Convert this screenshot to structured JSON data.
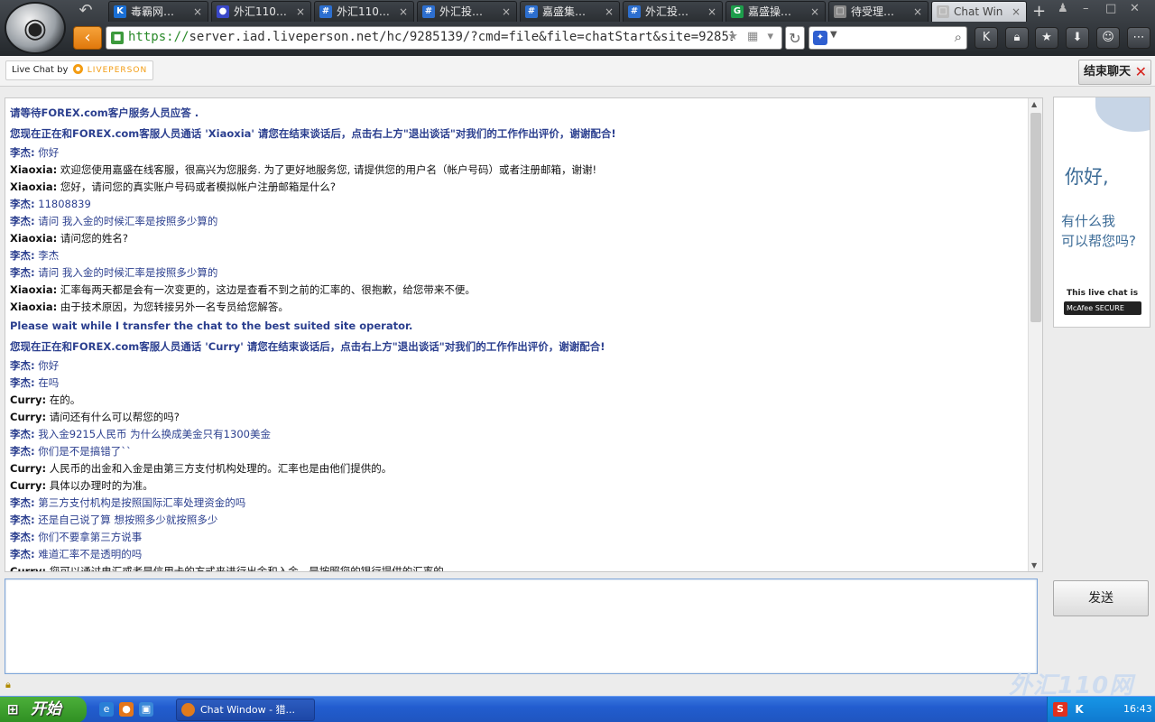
{
  "browser": {
    "tabs": [
      {
        "label": "毒霸网…",
        "icon": "K",
        "color": "#1a6fd4"
      },
      {
        "label": "外汇110…",
        "icon": "●",
        "color": "#3a48c8"
      },
      {
        "label": "外汇110…",
        "icon": "#",
        "color": "#2d6fcf"
      },
      {
        "label": "外汇投…",
        "icon": "#",
        "color": "#2d6fcf"
      },
      {
        "label": "嘉盛集…",
        "icon": "#",
        "color": "#2d6fcf"
      },
      {
        "label": "外汇投…",
        "icon": "#",
        "color": "#2d6fcf"
      },
      {
        "label": "嘉盛操…",
        "icon": "G",
        "color": "#1d9e4b"
      },
      {
        "label": "待受理…",
        "icon": "□",
        "color": "#888888"
      },
      {
        "label": "Chat Win",
        "icon": "□",
        "color": "#888888"
      }
    ],
    "close_glyph": "×",
    "url_scheme": "https://",
    "url_rest": "server.iad.liveperson.net/hc/9285139/?cmd=file&file=chatStart&site=9285139&s"
  },
  "lp": {
    "badge_prefix": "Live Chat by",
    "badge_brand": "LIVEPERSON",
    "end_chat": "结束聊天"
  },
  "transcript": [
    {
      "type": "sys",
      "text": "请等待FOREX.com客户服务人员应答 ."
    },
    {
      "type": "sys",
      "text": "您现在正在和FOREX.com客服人员通话 'Xiaoxia' 请您在结束谈话后，点击右上方\"退出谈话\"对我们的工作作出评价，谢谢配合!"
    },
    {
      "type": "user",
      "who": "李杰:",
      "text": "你好"
    },
    {
      "type": "agent",
      "who": "Xiaoxia:",
      "text": "欢迎您使用嘉盛在线客服，很高兴为您服务. 为了更好地服务您, 请提供您的用户名（帐户号码）或者注册邮箱，谢谢!"
    },
    {
      "type": "agent",
      "who": "Xiaoxia:",
      "text": "您好，请问您的真实账户号码或者模拟帐户注册邮箱是什么?"
    },
    {
      "type": "user",
      "who": "李杰:",
      "text": "11808839"
    },
    {
      "type": "user",
      "who": "李杰:",
      "text": "请问 我入金的时候汇率是按照多少算的"
    },
    {
      "type": "agent",
      "who": "Xiaoxia:",
      "text": "请问您的姓名?"
    },
    {
      "type": "user",
      "who": "李杰:",
      "text": "李杰"
    },
    {
      "type": "user",
      "who": "李杰:",
      "text": "请问 我入金的时候汇率是按照多少算的"
    },
    {
      "type": "agent",
      "who": "Xiaoxia:",
      "text": "汇率每两天都是会有一次变更的，这边是查看不到之前的汇率的、很抱歉，给您带来不便。"
    },
    {
      "type": "agent",
      "who": "Xiaoxia:",
      "text": "由于技术原因，为您转接另外一名专员给您解答。"
    },
    {
      "type": "sys",
      "text": "Please wait while I transfer the chat to the best suited site operator."
    },
    {
      "type": "sys",
      "text": "您现在正在和FOREX.com客服人员通话 'Curry' 请您在结束谈话后，点击右上方\"退出谈话\"对我们的工作作出评价，谢谢配合!"
    },
    {
      "type": "user",
      "who": "李杰:",
      "text": "你好"
    },
    {
      "type": "user",
      "who": "李杰:",
      "text": "在吗"
    },
    {
      "type": "agent",
      "who": "Curry:",
      "text": "在的。"
    },
    {
      "type": "agent",
      "who": "Curry:",
      "text": "请问还有什么可以帮您的吗?"
    },
    {
      "type": "user",
      "who": "李杰:",
      "text": "我入金9215人民币 为什么换成美金只有1300美金"
    },
    {
      "type": "user",
      "who": "李杰:",
      "text": "你们是不是搞错了``"
    },
    {
      "type": "agent",
      "who": "Curry:",
      "text": "人民币的出金和入金是由第三方支付机构处理的。汇率也是由他们提供的。"
    },
    {
      "type": "agent",
      "who": "Curry:",
      "text": "具体以办理时的为准。"
    },
    {
      "type": "user",
      "who": "李杰:",
      "text": "第三方支付机构是按照国际汇率处理资金的吗"
    },
    {
      "type": "user",
      "who": "李杰:",
      "text": "还是自己说了算 想按照多少就按照多少"
    },
    {
      "type": "user",
      "who": "李杰:",
      "text": "你们不要拿第三方说事"
    },
    {
      "type": "user",
      "who": "李杰:",
      "text": "难道汇率不是透明的吗"
    },
    {
      "type": "agent",
      "who": "Curry:",
      "text": "您可以通过电汇或者是信用卡的方式来进行出金和入金，是按照您的银行提供的汇率的。"
    }
  ],
  "ad": {
    "hello": "你好,",
    "help_line1": "有什么我",
    "help_line2": "可以帮您吗?",
    "live_chat_is": "This live chat is",
    "mcafee": "McAfee SECURE"
  },
  "input": {
    "placeholder": "",
    "value": ""
  },
  "send_label": "发送",
  "taskbar": {
    "start_label": "开始",
    "task_label": "Chat Window - 猎...",
    "clock": "16:43"
  },
  "watermark": "外汇110网"
}
